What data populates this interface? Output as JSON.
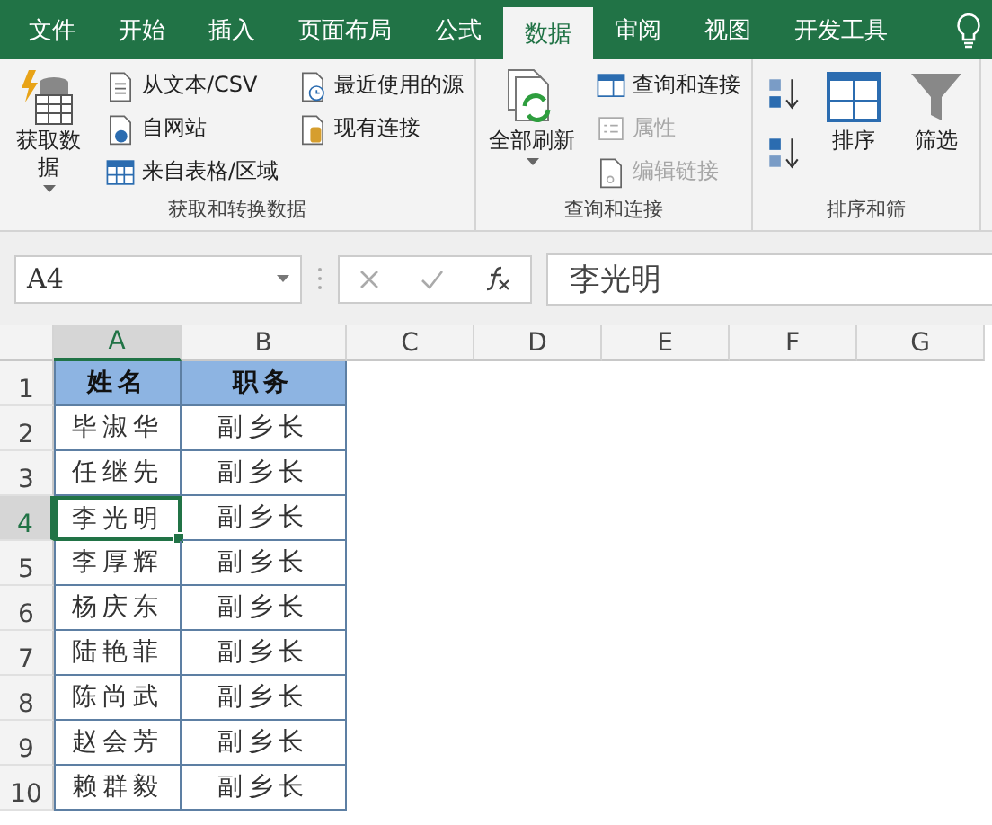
{
  "tabs": [
    {
      "label": "文件",
      "selected": false
    },
    {
      "label": "开始",
      "selected": false
    },
    {
      "label": "插入",
      "selected": false
    },
    {
      "label": "页面布局",
      "selected": false
    },
    {
      "label": "公式",
      "selected": false
    },
    {
      "label": "数据",
      "selected": true
    },
    {
      "label": "审阅",
      "selected": false
    },
    {
      "label": "视图",
      "selected": false
    },
    {
      "label": "开发工具",
      "selected": false
    }
  ],
  "ribbon": {
    "groups": [
      {
        "label": "获取和转换数据",
        "items": [
          {
            "kind": "large",
            "label": "获取数据",
            "disabled": false
          },
          {
            "kind": "small",
            "label": "从文本/CSV",
            "disabled": false
          },
          {
            "kind": "small",
            "label": "自网站",
            "disabled": false
          },
          {
            "kind": "small",
            "label": "来自表格/区域",
            "disabled": false
          },
          {
            "kind": "small",
            "label": "最近使用的源",
            "disabled": false
          },
          {
            "kind": "small",
            "label": "现有连接",
            "disabled": false
          }
        ]
      },
      {
        "label": "查询和连接",
        "items": [
          {
            "kind": "large",
            "label": "全部刷新",
            "disabled": false
          },
          {
            "kind": "small",
            "label": "查询和连接",
            "disabled": false
          },
          {
            "kind": "small",
            "label": "属性",
            "disabled": true
          },
          {
            "kind": "small",
            "label": "编辑链接",
            "disabled": true
          }
        ]
      },
      {
        "label": "排序和筛",
        "items": [
          {
            "kind": "icon"
          },
          {
            "kind": "icon"
          },
          {
            "kind": "large",
            "label": "排序",
            "disabled": false
          },
          {
            "kind": "large",
            "label": "筛选",
            "disabled": false
          }
        ]
      }
    ]
  },
  "formula_bar": {
    "name_box": "A4",
    "value": "李光明"
  },
  "sheet": {
    "columns": [
      {
        "label": "A",
        "selected": true
      },
      {
        "label": "B",
        "selected": false
      },
      {
        "label": "C",
        "selected": false
      },
      {
        "label": "D",
        "selected": false
      },
      {
        "label": "E",
        "selected": false
      },
      {
        "label": "F",
        "selected": false
      },
      {
        "label": "G",
        "selected": false
      }
    ],
    "rows": [
      {
        "label": "1",
        "kind": "header",
        "selected": false,
        "cells": [
          {
            "text": "姓名",
            "selected": false
          },
          {
            "text": "职务",
            "selected": false
          }
        ]
      },
      {
        "label": "2",
        "kind": "data",
        "selected": false,
        "cells": [
          {
            "text": "毕淑华",
            "selected": false
          },
          {
            "text": "副乡长",
            "selected": false
          }
        ]
      },
      {
        "label": "3",
        "kind": "data",
        "selected": false,
        "cells": [
          {
            "text": "任继先",
            "selected": false
          },
          {
            "text": "副乡长",
            "selected": false
          }
        ]
      },
      {
        "label": "4",
        "kind": "data",
        "selected": true,
        "cells": [
          {
            "text": "李光明",
            "selected": true
          },
          {
            "text": "副乡长",
            "selected": false
          }
        ]
      },
      {
        "label": "5",
        "kind": "data",
        "selected": false,
        "cells": [
          {
            "text": "李厚辉",
            "selected": false
          },
          {
            "text": "副乡长",
            "selected": false
          }
        ]
      },
      {
        "label": "6",
        "kind": "data",
        "selected": false,
        "cells": [
          {
            "text": "杨庆东",
            "selected": false
          },
          {
            "text": "副乡长",
            "selected": false
          }
        ]
      },
      {
        "label": "7",
        "kind": "data",
        "selected": false,
        "cells": [
          {
            "text": "陆艳菲",
            "selected": false
          },
          {
            "text": "副乡长",
            "selected": false
          }
        ]
      },
      {
        "label": "8",
        "kind": "data",
        "selected": false,
        "cells": [
          {
            "text": "陈尚武",
            "selected": false
          },
          {
            "text": "副乡长",
            "selected": false
          }
        ]
      },
      {
        "label": "9",
        "kind": "data",
        "selected": false,
        "cells": [
          {
            "text": "赵会芳",
            "selected": false
          },
          {
            "text": "副乡长",
            "selected": false
          }
        ]
      },
      {
        "label": "10",
        "kind": "data",
        "selected": false,
        "cells": [
          {
            "text": "赖群毅",
            "selected": false
          },
          {
            "text": "副乡长",
            "selected": false
          }
        ]
      }
    ]
  }
}
